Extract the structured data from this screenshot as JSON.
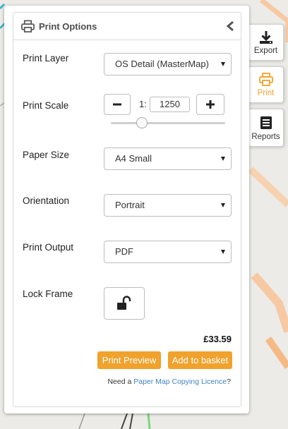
{
  "panel": {
    "title": "Print Options"
  },
  "form": {
    "print_layer": {
      "label": "Print Layer",
      "value": "OS Detail (MasterMap)"
    },
    "print_scale": {
      "label": "Print Scale",
      "prefix": "1:",
      "value": "1250",
      "slider_fraction": 0.27
    },
    "paper_size": {
      "label": "Paper Size",
      "value": "A4 Small"
    },
    "orientation": {
      "label": "Orientation",
      "value": "Portrait"
    },
    "print_output": {
      "label": "Print Output",
      "value": "PDF"
    },
    "lock_frame": {
      "label": "Lock Frame"
    }
  },
  "price": "£33.59",
  "buttons": {
    "preview": "Print Preview",
    "basket": "Add to basket"
  },
  "licence": {
    "prefix": "Need a ",
    "link": "Paper Map Copying Licence",
    "suffix": "?"
  },
  "side_tabs": [
    {
      "label": "Export",
      "icon": "download-icon"
    },
    {
      "label": "Print",
      "icon": "printer-icon"
    },
    {
      "label": "Reports",
      "icon": "document-list-icon"
    }
  ],
  "colors": {
    "accent": "#f0a22c",
    "link": "#3f84c4"
  }
}
